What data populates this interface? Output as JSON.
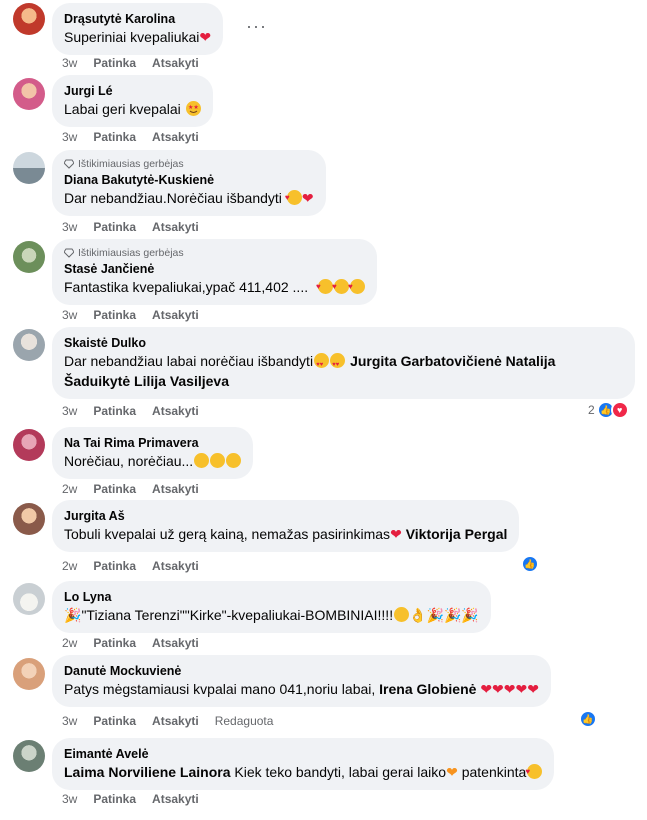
{
  "action_labels": {
    "like": "Patinka",
    "reply": "Atsakyti",
    "edited": "Redaguota"
  },
  "badge_text": "Ištikimiausias gerbėjas",
  "more_menu": "···",
  "comments": [
    {
      "author": "Drąsutytė Karolina",
      "text": "Superiniai kvepaliukai",
      "emojis": [
        "heart"
      ],
      "time": "3w",
      "avatar_color": "#c0392b"
    },
    {
      "author": "Jurgi Lé",
      "text": "Labai geri kvepalai",
      "emojis": [
        "star-eyes"
      ],
      "time": "3w",
      "avatar_color": "#d35c8a"
    },
    {
      "author": "Diana Bakutytė-Kuskienė",
      "text": "Dar nebandžiau.Norėčiau išbandyti",
      "emojis": [
        "hearts-face",
        "heart"
      ],
      "time": "3w",
      "avatar_color": "#7a8a94"
    },
    {
      "author": "Stasė Jančienė",
      "text": "Fantastika kvepaliukai,ypač 411,402 ....",
      "emojis": [
        "hearts-face",
        "hearts-face",
        "hearts-face"
      ],
      "time": "3w",
      "avatar_color": "#6c8f5b"
    },
    {
      "author": "Skaistė Dulko",
      "text_line1": "Dar nebandžiau labai norėčiau išbandyti",
      "mention1": "Jurgita Garbatovičienė",
      "mention2": "Natalija",
      "mention3": "Šaduikytė",
      "mention4": "Lilija Vasiljeva",
      "time": "3w",
      "reaction_count": "2",
      "avatar_color": "#9aa5ad"
    },
    {
      "author": "Na Tai Rima Primavera",
      "text": "Norėčiau, norėčiau...",
      "time": "2w",
      "avatar_color": "#b33a5a"
    },
    {
      "author": "Jurgita Aš",
      "text": "Tobuli kvepalai už gerą kainą, nemažas pasirinkimas",
      "mention": "Viktorija Pergal",
      "time": "2w",
      "avatar_color": "#8a5a4a"
    },
    {
      "author": "Lo Lyna",
      "text": "\"Tiziana Terenzi\"\"Kirke\"-kvepaliukai-BOMBINIAI!!!!",
      "time": "2w",
      "avatar_color": "#c9cfd3"
    },
    {
      "author": "Danutė Mockuvienė",
      "text": "Patys mėgstamiausi kvpalai mano 041,noriu labai,",
      "mention": "Irena Globienė",
      "time": "3w",
      "avatar_color": "#d9a07a"
    },
    {
      "author": "Eimantė Avelė",
      "mention": "Laima Norviliene Lainora",
      "text": "Kiek teko bandyti, labai gerai laiko",
      "text2": "patenkinta",
      "time": "3w",
      "avatar_color": "#6b7f73"
    }
  ]
}
